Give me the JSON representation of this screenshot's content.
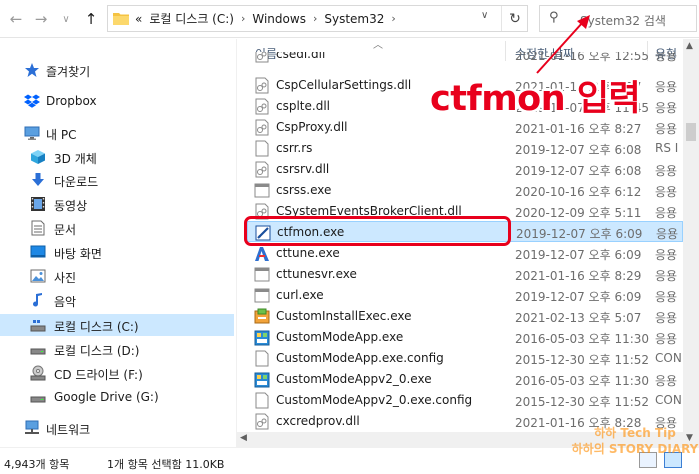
{
  "address_bar": {
    "overflow_label": "«",
    "crumbs": [
      "로컬 디스크 (C:)",
      "Windows",
      "System32"
    ],
    "separator": "›"
  },
  "search": {
    "placeholder": "System32 검색"
  },
  "sidebar": {
    "items": [
      {
        "label": "즐겨찾기",
        "icon": "star-icon"
      },
      {
        "label": "Dropbox",
        "icon": "dropbox-icon"
      },
      {
        "label": "내 PC",
        "icon": "pc-icon"
      },
      {
        "label": "3D 개체",
        "icon": "cube-3d-icon"
      },
      {
        "label": "다운로드",
        "icon": "download-icon"
      },
      {
        "label": "동영상",
        "icon": "video-icon"
      },
      {
        "label": "문서",
        "icon": "document-icon"
      },
      {
        "label": "바탕 화면",
        "icon": "desktop-icon"
      },
      {
        "label": "사진",
        "icon": "picture-icon"
      },
      {
        "label": "음악",
        "icon": "music-icon"
      },
      {
        "label": "로컬 디스크 (C:)",
        "icon": "drive-icon",
        "selected": true
      },
      {
        "label": "로컬 디스크 (D:)",
        "icon": "drive-icon"
      },
      {
        "label": "CD 드라이브 (F:)",
        "icon": "cd-drive-icon"
      },
      {
        "label": "Google Drive (G:)",
        "icon": "drive-icon"
      },
      {
        "label": "네트워크",
        "icon": "network-icon"
      }
    ]
  },
  "columns": {
    "name": "이름",
    "date": "수정한 날짜",
    "type": "유형"
  },
  "files": [
    {
      "name": "csedl.dll",
      "date": "2021-01-16 오후 12:55",
      "type": "응용",
      "icon": "dll-icon"
    },
    {
      "name": "CspCellularSettings.dll",
      "date": "2021-01-16 오후 8:27",
      "type": "응용",
      "icon": "dll-icon"
    },
    {
      "name": "csplte.dll",
      "date": "2019-12-07 오후 11:45",
      "type": "응용",
      "icon": "dll-icon"
    },
    {
      "name": "CspProxy.dll",
      "date": "2021-01-16 오후 8:27",
      "type": "응용",
      "icon": "dll-icon"
    },
    {
      "name": "csrr.rs",
      "date": "2019-12-07 오후 6:08",
      "type": "RS I",
      "icon": "file-icon"
    },
    {
      "name": "csrsrv.dll",
      "date": "2019-12-07 오후 6:08",
      "type": "응용",
      "icon": "dll-icon"
    },
    {
      "name": "csrss.exe",
      "date": "2020-10-16 오후 6:12",
      "type": "응용",
      "icon": "exe-icon"
    },
    {
      "name": "CSystemEventsBrokerClient.dll",
      "date": "2020-12-09 오후 5:11",
      "type": "응용",
      "icon": "dll-icon"
    },
    {
      "name": "ctfmon.exe",
      "date": "2019-12-07 오후 6:09",
      "type": "응용",
      "icon": "ctfmon-icon",
      "selected": true
    },
    {
      "name": "cttune.exe",
      "date": "2019-12-07 오후 6:09",
      "type": "응용",
      "icon": "cttune-icon"
    },
    {
      "name": "cttunesvr.exe",
      "date": "2021-01-16 오후 8:29",
      "type": "응용",
      "icon": "exe-icon"
    },
    {
      "name": "curl.exe",
      "date": "2019-12-07 오후 6:09",
      "type": "응용",
      "icon": "exe-icon"
    },
    {
      "name": "CustomInstallExec.exe",
      "date": "2021-02-13 오후 5:07",
      "type": "응용",
      "icon": "installer-icon"
    },
    {
      "name": "CustomModeApp.exe",
      "date": "2016-05-03 오후 11:30",
      "type": "응용",
      "icon": "app-icon"
    },
    {
      "name": "CustomModeApp.exe.config",
      "date": "2015-12-30 오후 11:52",
      "type": "CON",
      "icon": "file-icon"
    },
    {
      "name": "CustomModeAppv2_0.exe",
      "date": "2016-05-03 오후 11:30",
      "type": "응용",
      "icon": "app-icon"
    },
    {
      "name": "CustomModeAppv2_0.exe.config",
      "date": "2015-12-30 오후 11:52",
      "type": "CON",
      "icon": "file-icon"
    },
    {
      "name": "cxcredprov.dll",
      "date": "2021-01-16 오후 8:28",
      "type": "응용",
      "icon": "dll-icon"
    }
  ],
  "status": {
    "item_count": "4,943개 항목",
    "selection": "1개 항목 선택함 11.0KB"
  },
  "annotation": {
    "callout": "ctfmon 입력"
  },
  "watermark": {
    "line1": "하하 Tech Tip",
    "line2": "하하의 STORY DIARY"
  },
  "colors": {
    "accent_red": "#e8001c",
    "selection_bg": "#cce8ff",
    "selection_border": "#99d1ff"
  }
}
